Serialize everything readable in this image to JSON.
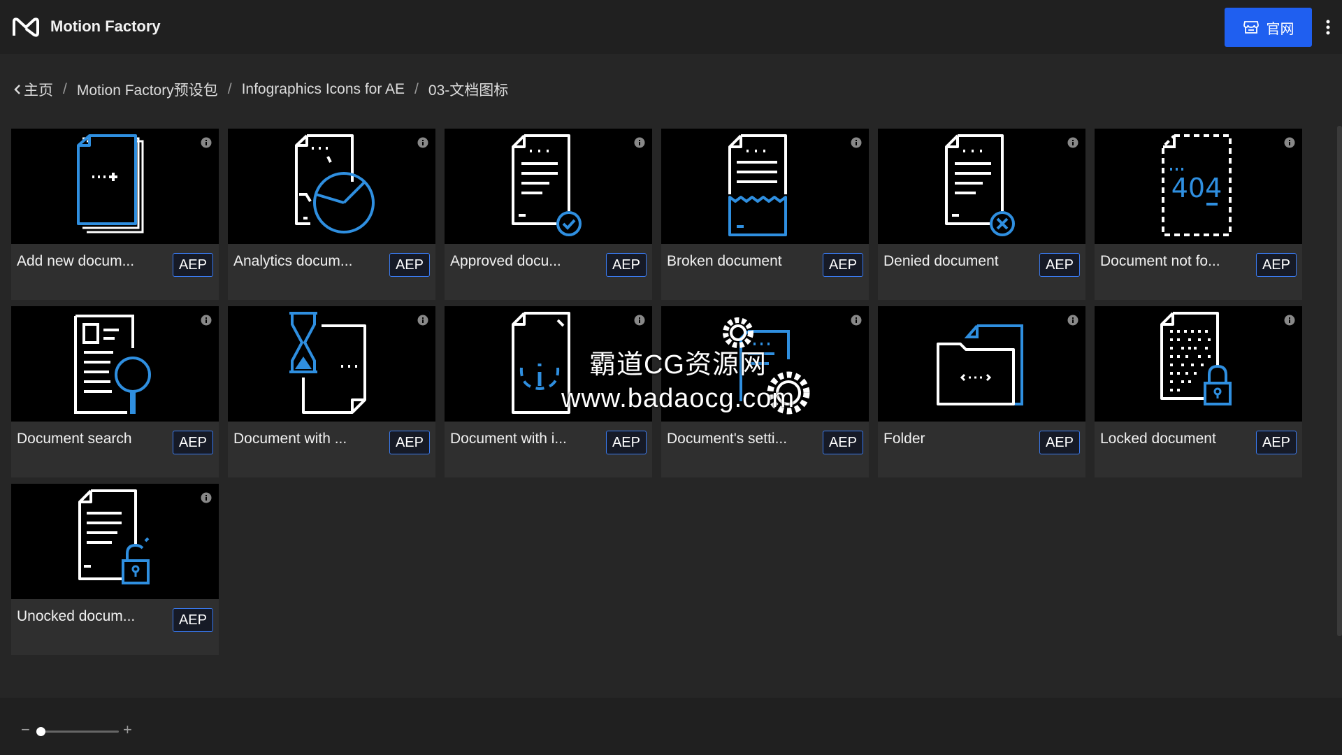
{
  "app": {
    "title": "Motion Factory",
    "logo_icon": "mf-logo-icon"
  },
  "header": {
    "site_button_label": "官网",
    "site_button_icon": "store-icon",
    "more_icon": "more-vertical-icon",
    "accent": "#1f5ff0"
  },
  "breadcrumb": {
    "items": [
      "主页",
      "Motion Factory预设包",
      "Infographics Icons for AE",
      "03-文档图标"
    ],
    "separator": "/"
  },
  "cards": [
    {
      "name": "Add new docum...",
      "badge": "AEP"
    },
    {
      "name": "Analytics docum...",
      "badge": "AEP"
    },
    {
      "name": "Approved docu...",
      "badge": "AEP"
    },
    {
      "name": "Broken document",
      "badge": "AEP"
    },
    {
      "name": "Denied document",
      "badge": "AEP"
    },
    {
      "name": "Document not fo...",
      "badge": "AEP"
    },
    {
      "name": "Document search",
      "badge": "AEP"
    },
    {
      "name": "Document with ...",
      "badge": "AEP"
    },
    {
      "name": "Document with i...",
      "badge": "AEP"
    },
    {
      "name": "Document's setti...",
      "badge": "AEP"
    },
    {
      "name": "Folder",
      "badge": "AEP"
    },
    {
      "name": "Locked document",
      "badge": "AEP"
    },
    {
      "name": "Unocked docum...",
      "badge": "AEP"
    }
  ],
  "watermark": {
    "line1": "霸道CG资源网",
    "line2": "www.badaocg.com"
  },
  "icon_colors": {
    "white": "#ffffff",
    "blue": "#2f8fe0"
  }
}
